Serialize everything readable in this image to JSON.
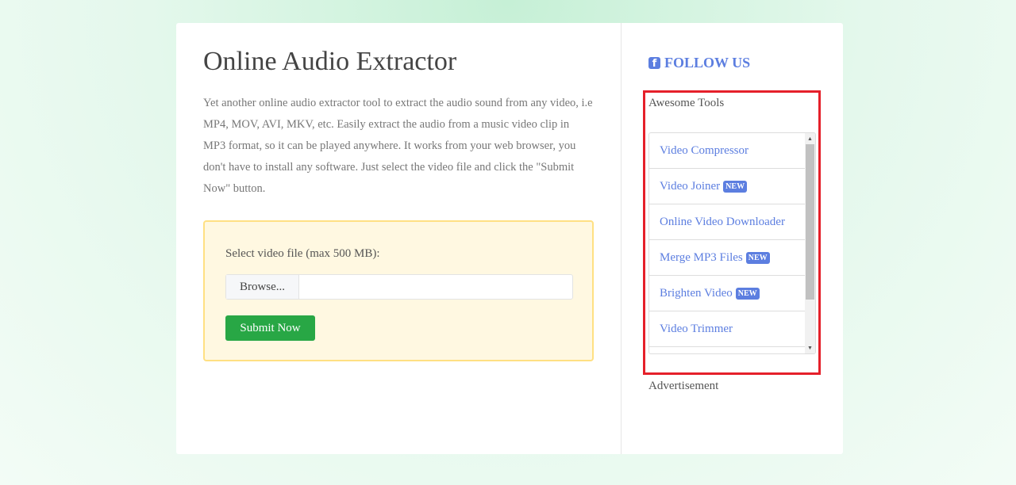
{
  "main": {
    "title": "Online Audio Extractor",
    "description": "Yet another online audio extractor tool to extract the audio sound from any video, i.e MP4, MOV, AVI, MKV, etc. Easily extract the audio from a music video clip in MP3 format, so it can be played anywhere. It works from your web browser, you don't have to install any software. Just select the video file and click the \"Submit Now\" button.",
    "form": {
      "label": "Select video file (max 500 MB):",
      "browse": "Browse...",
      "file_value": "",
      "submit": "Submit Now"
    }
  },
  "sidebar": {
    "follow": "FOLLOW US",
    "tools_title": "Awesome Tools",
    "new_badge": "NEW",
    "items": [
      {
        "label": "Video Compressor",
        "new": false
      },
      {
        "label": "Video Joiner",
        "new": true
      },
      {
        "label": "Online Video Downloader",
        "new": false
      },
      {
        "label": "Merge MP3 Files",
        "new": true
      },
      {
        "label": "Brighten Video",
        "new": true
      },
      {
        "label": "Video Trimmer",
        "new": false
      }
    ],
    "advertisement": "Advertisement"
  },
  "colors": {
    "accent": "#5c7ee0",
    "submit": "#28a745",
    "highlight": "#e5202a"
  }
}
